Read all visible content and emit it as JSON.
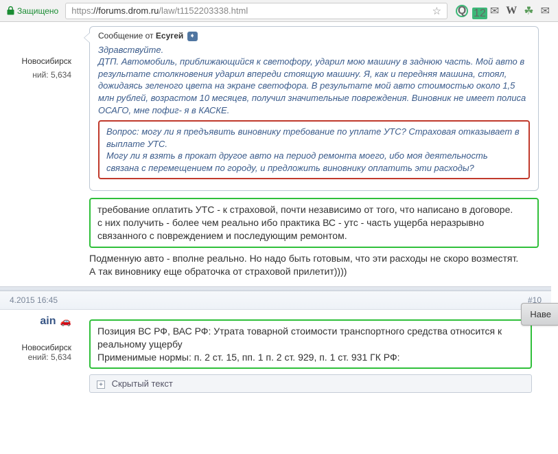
{
  "browser": {
    "secure_label": "Защищено",
    "url_scheme": "https",
    "url_host": "://forums.drom.ru",
    "url_path": "/law/t1152203338.html",
    "ext_badge": "12"
  },
  "post1": {
    "sidebar": {
      "city": "Новосибирск",
      "posts_label": "ний:  5,634"
    },
    "quote": {
      "label_prefix": "Сообщение от ",
      "author": "Есугей",
      "greeting": "Здравствуйте.",
      "body": "ДТП. Автомобиль, приближающийся к светофору, ударил мою машину в заднюю часть. Мой авто в результате столкновения ударил впереди стоящую машину. Я, как и передняя машина, стоял, дожидаясь зеленого цвета на экране светофора. В результате мой авто стоимостью около 1,5 млн рублей, возрастом 10 месяцев, получил значительные повреждения. Виновник не имеет полиса ОСАГО, мне пофиг- я в КАСКЕ.",
      "question": "Вопрос: могу ли я предъявить виновнику требование по уплате УТС? Страховая отказывает в выплате УТС.\nМогу ли я взять в прокат другое авто на период ремонта моего, ибо моя деятельность связана с перемещением по городу, и предложить виновнику оплатить эти расходы?"
    },
    "answer_green": "требование оплатить УТС - к страховой, почти независимо от того, что написано в договоре.\nс них получить - более чем реально ибо практика ВС - утс - часть ущерба неразрывно связанного с повреждением и последующим ремонтом.",
    "answer_rest": "Подменную авто - вполне реально. Но надо быть готовым, что эти расходы не скоро возместят.\nА так виновнику еще обраточка от страховой прилетит))))",
    "reply_btn": "Наве"
  },
  "post2": {
    "header": {
      "date": "4.2015 16:45",
      "num": "#10"
    },
    "sidebar": {
      "username": "ain",
      "city": "Новосибирск",
      "posts_label": "ений:  5,634"
    },
    "green": "Позиция ВС РФ, ВАС РФ: Утрата товарной стоимости транспортного средства относится к реальному ущербу\nПрименимые нормы: п. 2 ст. 15, пп. 1 п. 2 ст. 929, п. 1 ст. 931 ГК РФ:",
    "spoiler_label": "Скрытый текст"
  }
}
